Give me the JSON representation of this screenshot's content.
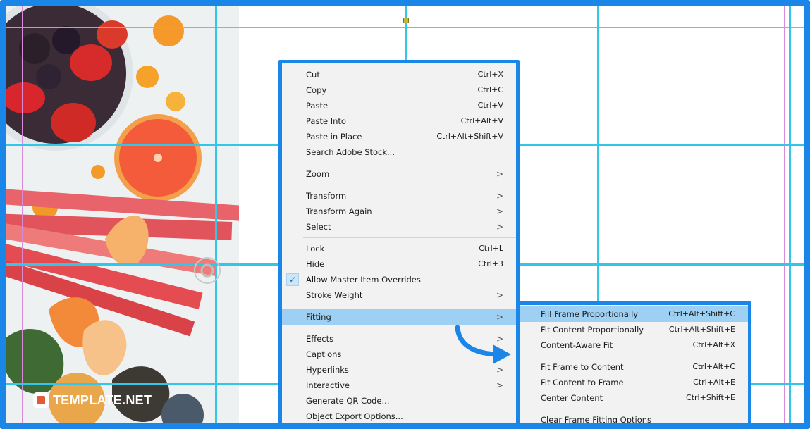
{
  "menu": {
    "items": [
      {
        "label": "Cut",
        "shortcut": "Ctrl+X"
      },
      {
        "label": "Copy",
        "shortcut": "Ctrl+C"
      },
      {
        "label": "Paste",
        "shortcut": "Ctrl+V"
      },
      {
        "label": "Paste Into",
        "shortcut": "Ctrl+Alt+V"
      },
      {
        "label": "Paste in Place",
        "shortcut": "Ctrl+Alt+Shift+V"
      },
      {
        "label": "Search Adobe Stock...",
        "shortcut": ""
      },
      {
        "label": "Zoom",
        "submenu": true
      },
      {
        "label": "Transform",
        "submenu": true
      },
      {
        "label": "Transform Again",
        "submenu": true
      },
      {
        "label": "Select",
        "submenu": true
      },
      {
        "label": "Lock",
        "shortcut": "Ctrl+L"
      },
      {
        "label": "Hide",
        "shortcut": "Ctrl+3"
      },
      {
        "label": "Allow Master Item Overrides",
        "checked": true
      },
      {
        "label": "Stroke Weight",
        "submenu": true
      },
      {
        "label": "Fitting",
        "submenu": true,
        "highlighted": true
      },
      {
        "label": "Effects",
        "submenu": true
      },
      {
        "label": "Captions",
        "submenu": true
      },
      {
        "label": "Hyperlinks",
        "submenu": true
      },
      {
        "label": "Interactive",
        "submenu": true
      },
      {
        "label": "Generate QR Code..."
      },
      {
        "label": "Object Export Options..."
      }
    ],
    "arrow_glyph": ">",
    "check_glyph": "✓"
  },
  "submenu": {
    "items": [
      {
        "label": "Fill Frame Proportionally",
        "shortcut": "Ctrl+Alt+Shift+C"
      },
      {
        "label": "Fit Content Proportionally",
        "shortcut": "Ctrl+Alt+Shift+E"
      },
      {
        "label": "Content-Aware Fit",
        "shortcut": "Ctrl+Alt+X"
      },
      {
        "label": "Fit Frame to Content",
        "shortcut": "Ctrl+Alt+C"
      },
      {
        "label": "Fit Content to Frame",
        "shortcut": "Ctrl+Alt+E"
      },
      {
        "label": "Center Content",
        "shortcut": "Ctrl+Shift+E"
      },
      {
        "label": "Clear Frame Fitting Options",
        "shortcut": ""
      }
    ]
  },
  "watermark": {
    "text": "TEMPLATE.NET"
  },
  "colors": {
    "accent_border": "#1a86e8",
    "grid_guide": "#33c6e8",
    "margin_guide": "#d98ad9",
    "highlight": "#9dd0f2",
    "menu_bg": "#f2f2f2"
  }
}
